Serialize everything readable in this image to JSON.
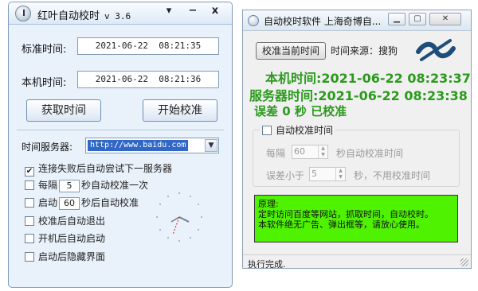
{
  "left_window": {
    "title": "红叶自动校时",
    "version": "v 3.6",
    "labels": {
      "standard_time": "标准时间:",
      "local_time": "本机时间:",
      "time_server": "时间服务器:"
    },
    "standard_time": "2021-06-22  08:21:35",
    "local_time": "2021-06-22  08:21:36",
    "buttons": {
      "get_time": "获取时间",
      "start_sync": "开始校准"
    },
    "server_value": "http://www.baidu.com",
    "options": {
      "try_next_server": "连接失败后自动尝试下一服务器",
      "every_prefix": "每隔",
      "every_value": "5",
      "every_suffix": "秒自动校准一次",
      "startup_prefix": "启动",
      "startup_value": "60",
      "startup_suffix": "秒后自动校准",
      "exit_after_sync": "校准后自动退出",
      "run_at_boot": "开机后自动启动",
      "hide_after_start": "启动后隐藏界面"
    },
    "check_mark": "✔",
    "colors": {
      "frame": "#e9f1fa",
      "clock_hand": "#cc2222"
    }
  },
  "right_window": {
    "title": "自动校时软件 上海奇博自...",
    "sync_now_button": "校准当前时间",
    "time_source": "时间来源：搜狗",
    "local_time_line": "本机时间:2021-06-22 08:23:37",
    "server_time_line": "服务器时间:2021-06-22 08:23:38",
    "error_line": "误差 0 秒  已校准",
    "auto_sync_label": "自动校准时间",
    "interval_prefix": "每隔",
    "interval_value": "60",
    "interval_suffix": "秒自动校准时间",
    "threshold_prefix": "误差小于",
    "threshold_value": "5",
    "threshold_suffix": "秒，不用校准时间",
    "principle_lines": [
      "原理:",
      "定时访问百度等网站，抓取时间，自动校时。",
      "本软件绝无广告、弹出框等，请放心使用。"
    ],
    "status": "执行完成.",
    "colors": {
      "green_text": "#2b9a1c",
      "principle_bg": "#4ff200"
    }
  }
}
